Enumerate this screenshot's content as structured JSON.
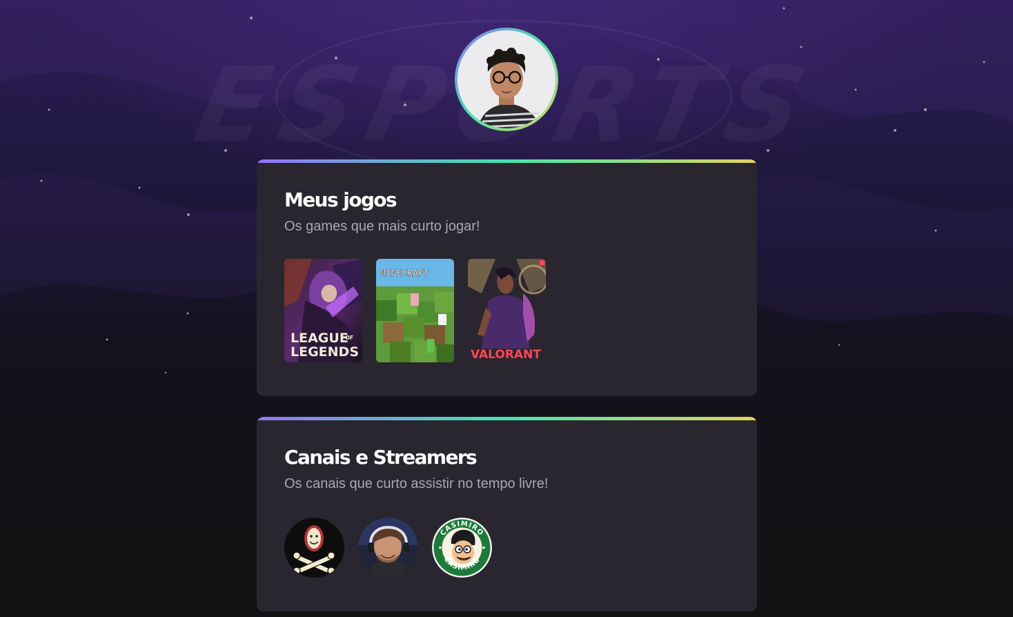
{
  "background": {
    "logo_text": "ESPORTS"
  },
  "profile": {
    "avatar_alt": "Foto de perfil"
  },
  "games_section": {
    "title": "Meus jogos",
    "subtitle": "Os games que mais curto jogar!",
    "games": [
      {
        "name": "League of Legends",
        "logo_line1": "LEAGUE",
        "logo_of": "OF",
        "logo_line2": "LEGENDS"
      },
      {
        "name": "Minecraft",
        "logo": "MINECRAFT"
      },
      {
        "name": "Valorant",
        "logo": "VALORANT"
      }
    ]
  },
  "streams_section": {
    "title": "Canais e Streamers",
    "subtitle": "Os canais que curto assistir no tempo livre!",
    "channels": [
      {
        "name": "channel-skull"
      },
      {
        "name": "channel-gamer"
      },
      {
        "name": "Casimiro",
        "badge_text_top": "CASIMIRO",
        "badge_text_bottom": "CASIMIRO"
      }
    ]
  },
  "colors": {
    "accent_gradient": [
      "#9572fc",
      "#43e7ad",
      "#e2d45c"
    ],
    "card_bg": "#29262f",
    "title": "#ffffff",
    "subtitle": "#a9a9b2"
  }
}
